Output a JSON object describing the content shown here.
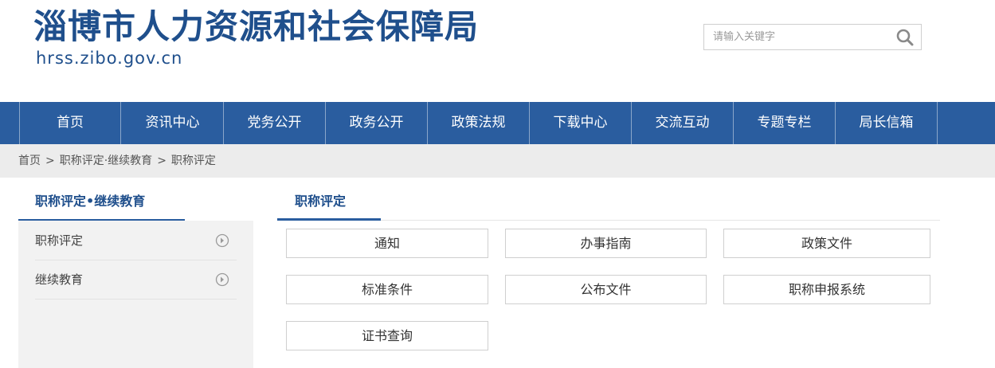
{
  "header": {
    "title": "淄博市人力资源和社会保障局",
    "domain": "hrss.zibo.gov.cn"
  },
  "search": {
    "placeholder": "请输入关键字",
    "icon": "search-icon"
  },
  "nav": {
    "items": [
      "首页",
      "资讯中心",
      "党务公开",
      "政务公开",
      "政策法规",
      "下载中心",
      "交流互动",
      "专题专栏",
      "局长信箱"
    ]
  },
  "breadcrumb": {
    "items": [
      "首页",
      "职称评定·继续教育",
      "职称评定"
    ],
    "separator": ">"
  },
  "sidebar": {
    "title": "职称评定•继续教育",
    "items": [
      "职称评定",
      "继续教育"
    ]
  },
  "main": {
    "title": "职称评定",
    "tiles": [
      "通知",
      "办事指南",
      "政策文件",
      "标准条件",
      "公布文件",
      "职称申报系统",
      "证书查询"
    ]
  },
  "colors": {
    "brand": "#1f4f8c",
    "nav_bg": "#2a5d9f",
    "breadcrumb_bg": "#ececec",
    "sidebar_bg": "#f2f2f2"
  }
}
